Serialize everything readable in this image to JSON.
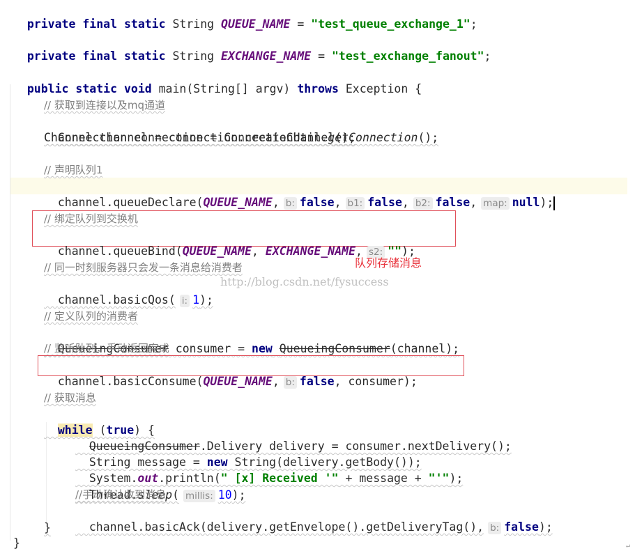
{
  "code": {
    "l1": {
      "kw": "private final static",
      "type": " String ",
      "name": "QUEUE_NAME",
      "eq": " = ",
      "value": "\"test_queue_exchange_1\"",
      "end": ";"
    },
    "l2": {
      "kw": "private final static",
      "type": " String ",
      "name": "EXCHANGE_NAME",
      "eq": " = ",
      "value": "\"test_exchange_fanout\"",
      "end": ";"
    },
    "l3": {
      "kw": "public static void",
      "sig": " main(String[] argv) ",
      "throws": "throws",
      "rest": " Exception {"
    },
    "c1": "// 获取到连接以及mq通道",
    "l4": {
      "pre": "Connection connection = ConnectionUtil.",
      "method": "getConnection",
      "post": "();"
    },
    "l5": "Channel channel = connection.createChannel();",
    "c2": "// 声明队列1",
    "l6": {
      "pre": "channel.queueDeclare(",
      "arg1": "QUEUE_NAME",
      "comma": ",",
      "hint_b": "b:",
      "v_b": "false",
      "hint_b1": "b1:",
      "v_b1": "false",
      "hint_b2": "b2:",
      "v_b2": "false",
      "hint_map": "map:",
      "v_map": "null",
      "end": ");"
    },
    "c3": "// 绑定队列到交换机",
    "l7": {
      "pre": "channel.queueBind(",
      "arg1": "QUEUE_NAME",
      "arg2": "EXCHANGE_NAME",
      "hint_s2": "s2:",
      "v_s2": "\"\"",
      "end": ");"
    },
    "c4": "// 同一时刻服务器只会发一条消息给消费者",
    "l8": {
      "pre": "channel.basicQos(",
      "hint_i": "i:",
      "v_i": "1",
      "end": ");"
    },
    "c5": "// 定义队列的消费者",
    "l9": {
      "type": "QueueingConsumer",
      "mid": " consumer = ",
      "new": "new",
      "ctor": "QueueingConsumer",
      "end": "(channel);"
    },
    "c6": "// 监听队列，手动返回完成",
    "l10": {
      "pre": "channel.basicConsume(",
      "arg1": "QUEUE_NAME",
      "hint_b": "b:",
      "v_b": "false",
      "end": ", consumer);"
    },
    "c7": "// 获取消息",
    "l11": {
      "while": "while",
      "open": " (",
      "true": "true",
      "close": ") {"
    },
    "l12": {
      "type": "QueueingConsumer",
      "rest": ".Delivery delivery = consumer.nextDelivery();"
    },
    "l13": {
      "pre": "String message = ",
      "new": "new",
      "post": " String(delivery.getBody());"
    },
    "l14": {
      "pre": "System.",
      "field": "out",
      "mid": ".println(",
      "s1": "\" [x] Received '\"",
      "plus": " + message + ",
      "s2": "\"'\"",
      "end": ");"
    },
    "l15": {
      "pre": "Thread.",
      "method": "sleep",
      "open": "(",
      "hint": "millis:",
      "v": "10",
      "end": ");"
    },
    "c8": "//手动确认收到消息",
    "l16": {
      "pre": "channel.basicAck(delivery.getEnvelope().getDeliveryTag(),",
      "hint_b": "b:",
      "v_b": "false",
      "end": ");"
    },
    "l17": "}",
    "l18": "}"
  },
  "annotations": {
    "red_label": "队列存储消息",
    "watermark": "http://blog.csdn.net/fysuccess",
    "box_color": "#e0505a",
    "label_color": "#e8313a"
  }
}
